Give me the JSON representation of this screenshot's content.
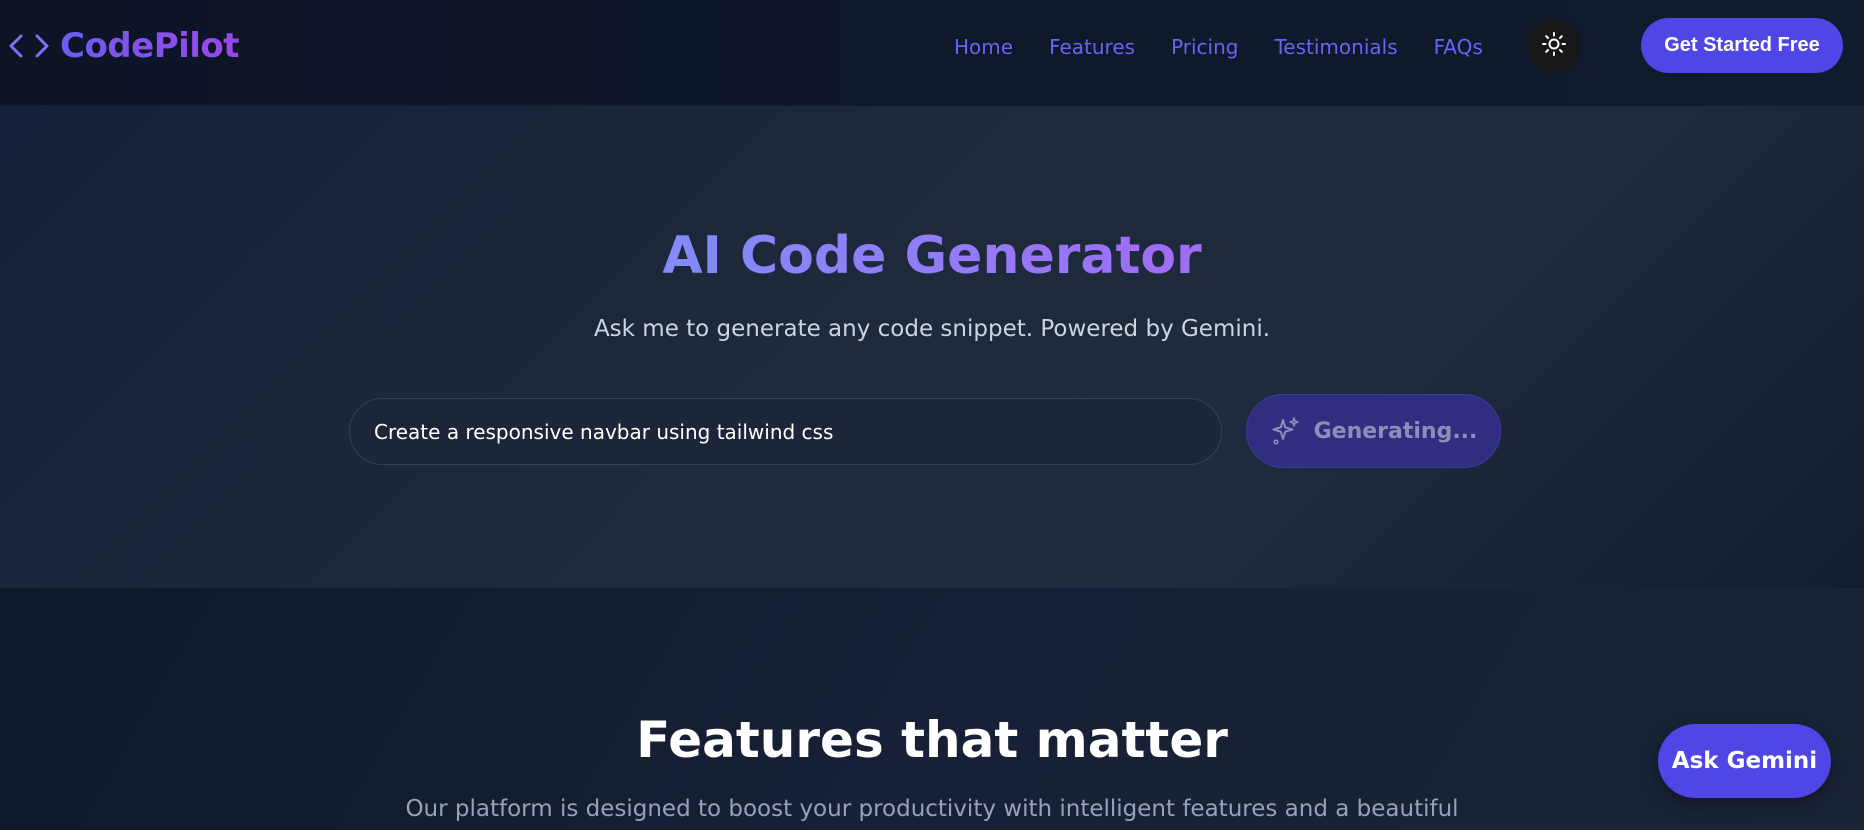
{
  "navbar": {
    "brand_name": "CodePilot",
    "brand_icon": "code-brackets-icon",
    "links": [
      {
        "label": "Home"
      },
      {
        "label": "Features"
      },
      {
        "label": "Pricing"
      },
      {
        "label": "Testimonials"
      },
      {
        "label": "FAQs"
      }
    ],
    "theme_toggle_icon": "sun-icon",
    "cta_label": "Get Started Free"
  },
  "hero": {
    "title": "AI Code Generator",
    "subtitle": "Ask me to generate any code snippet. Powered by Gemini.",
    "prompt_value": "Create a responsive navbar using tailwind css",
    "generate_icon": "sparkles-icon",
    "generate_label": "Generating..."
  },
  "features": {
    "title": "Features that matter",
    "description": "Our platform is designed to boost your productivity with intelligent features and a beautiful"
  },
  "floating": {
    "ask_label": "Ask Gemini"
  },
  "colors": {
    "accent": "#4f46e5",
    "link": "#6366f1",
    "page_bg": "#0f172a"
  }
}
